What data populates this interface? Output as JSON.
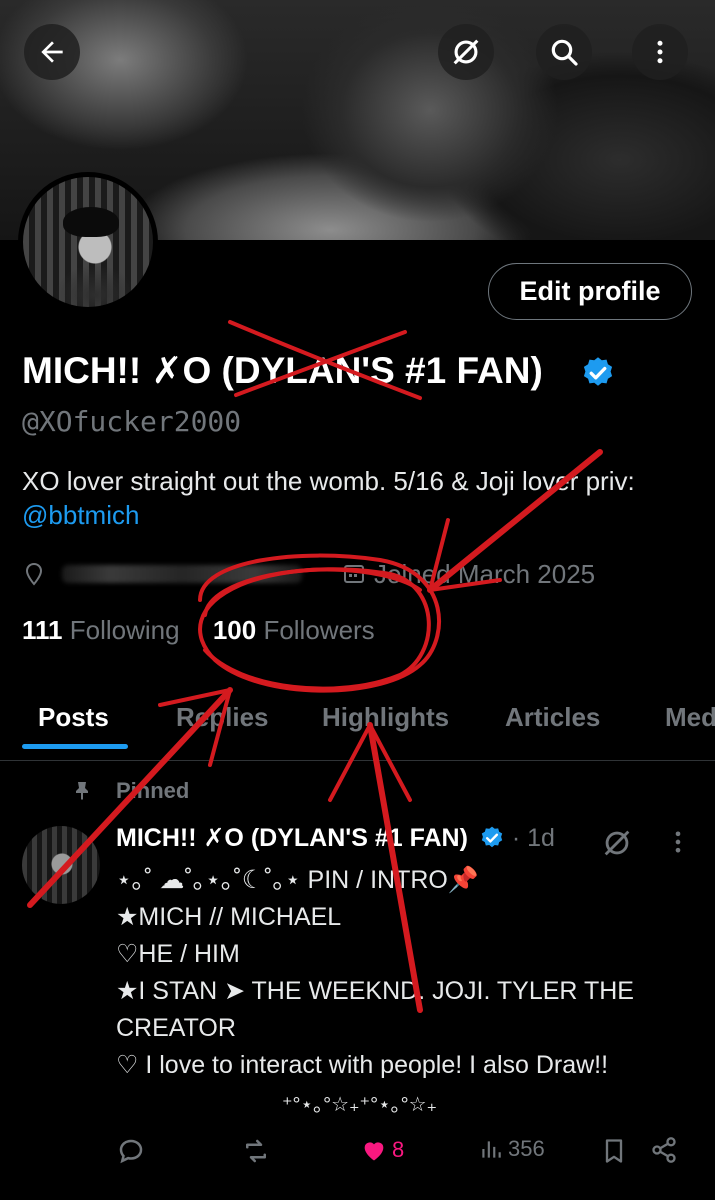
{
  "profile": {
    "name": "MICH!! ✗O (DYLAN'S #1 FAN)",
    "handle": "@XOfucker2000",
    "bio": "XO lover straight out the womb.  5/16 & Joji lover priv:",
    "bio_link": "@bbtmich",
    "joined": "Joined March 2025",
    "following_count": "111",
    "following_label": "Following",
    "followers_count": "100",
    "followers_label": "Followers"
  },
  "header": {
    "edit_profile_label": "Edit profile"
  },
  "tabs": [
    {
      "label": "Posts"
    },
    {
      "label": "Replies"
    },
    {
      "label": "Highlights"
    },
    {
      "label": "Articles"
    },
    {
      "label": "Media"
    }
  ],
  "pinned_post": {
    "pinned_label": "Pinned",
    "author_name": "MICH!! ✗O (DYLAN'S #1 FAN)",
    "date": "· 1d",
    "lines": [
      "⋆｡˚ ☁︎˚｡⋆｡˚☾˚｡⋆ PIN / INTRO📌",
      "★MICH // MICHAEL",
      "♡HE / HIM",
      "★I STAN ➤ THE WEEKND. JOJI. TYLER THE",
      "CREATOR",
      "♡ I love to interact with people! I also Draw!!"
    ],
    "sparkles": "⁺°⋆｡°☆₊⁺°⋆｡°☆₊",
    "likes": "8",
    "views": "356"
  },
  "colors": {
    "accent": "#1d9bf0",
    "like": "#f91880",
    "annotation": "#d41a1f"
  }
}
